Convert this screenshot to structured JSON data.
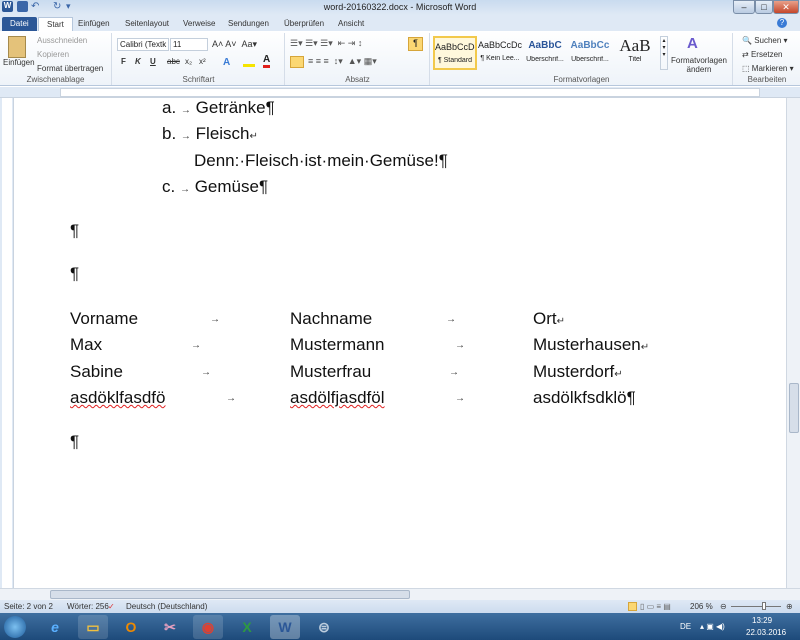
{
  "window": {
    "title": "word-20160322.docx - Microsoft Word",
    "minimize": "–",
    "maximize": "□",
    "close": "✕"
  },
  "tabs": [
    "Datei",
    "Start",
    "Einfügen",
    "Seitenlayout",
    "Verweise",
    "Sendungen",
    "Überprüfen",
    "Ansicht"
  ],
  "ribbon": {
    "clipboard": {
      "paste": "Einfügen",
      "cut": "Ausschneiden",
      "copy": "Kopieren",
      "format_painter": "Format übertragen",
      "label": "Zwischenablage"
    },
    "font": {
      "name": "Calibri (Textk",
      "size": "11",
      "label": "Schriftart",
      "bold": "F",
      "italic": "K",
      "underline": "U",
      "strike": "abc",
      "sub": "x₂",
      "sup": "x²"
    },
    "paragraph": {
      "label": "Absatz",
      "pilcrow": "¶"
    },
    "styles": {
      "label": "Formatvorlagen",
      "items": [
        {
          "sample": "AaBbCcDc",
          "name": "¶ Standard"
        },
        {
          "sample": "AaBbCcDc",
          "name": "¶ Kein Lee..."
        },
        {
          "sample": "AaBbC",
          "name": "Überschrif..."
        },
        {
          "sample": "AaBbCc",
          "name": "Überschrif..."
        },
        {
          "sample": "AaB",
          "name": "Titel"
        }
      ],
      "change": "Formatvorlagen ändern"
    },
    "editing": {
      "label": "Bearbeiten",
      "find": "Suchen",
      "replace": "Ersetzen",
      "select": "Markieren"
    }
  },
  "document": {
    "list": [
      {
        "marker": "a.",
        "text": "Getränke",
        "end": "¶"
      },
      {
        "marker": "b.",
        "text": "Fleisch",
        "end": "↵"
      },
      {
        "marker": "",
        "text": "Denn:·Fleisch·ist·mein·Gemüse!",
        "end": "¶"
      },
      {
        "marker": "c.",
        "text": "Gemüse",
        "end": "¶"
      }
    ],
    "empty_para": "¶",
    "tab_arrow": "→",
    "table": [
      [
        "Vorname",
        "Nachname",
        "Ort",
        "↵"
      ],
      [
        "Max",
        "Mustermann",
        "Musterhausen",
        "↵"
      ],
      [
        "Sabine",
        "Musterfrau",
        "Musterdorf",
        "↵"
      ],
      [
        "asdöklfasdfö",
        "asdölfjasdföl",
        "asdölkfsdklö",
        "¶"
      ]
    ]
  },
  "status": {
    "page": "Seite: 2 von 2",
    "words": "Wörter: 256",
    "language": "Deutsch (Deutschland)",
    "zoom": "206 %"
  },
  "taskbar": {
    "lang": "DE",
    "time": "13:29",
    "date": "22.03.2016"
  }
}
